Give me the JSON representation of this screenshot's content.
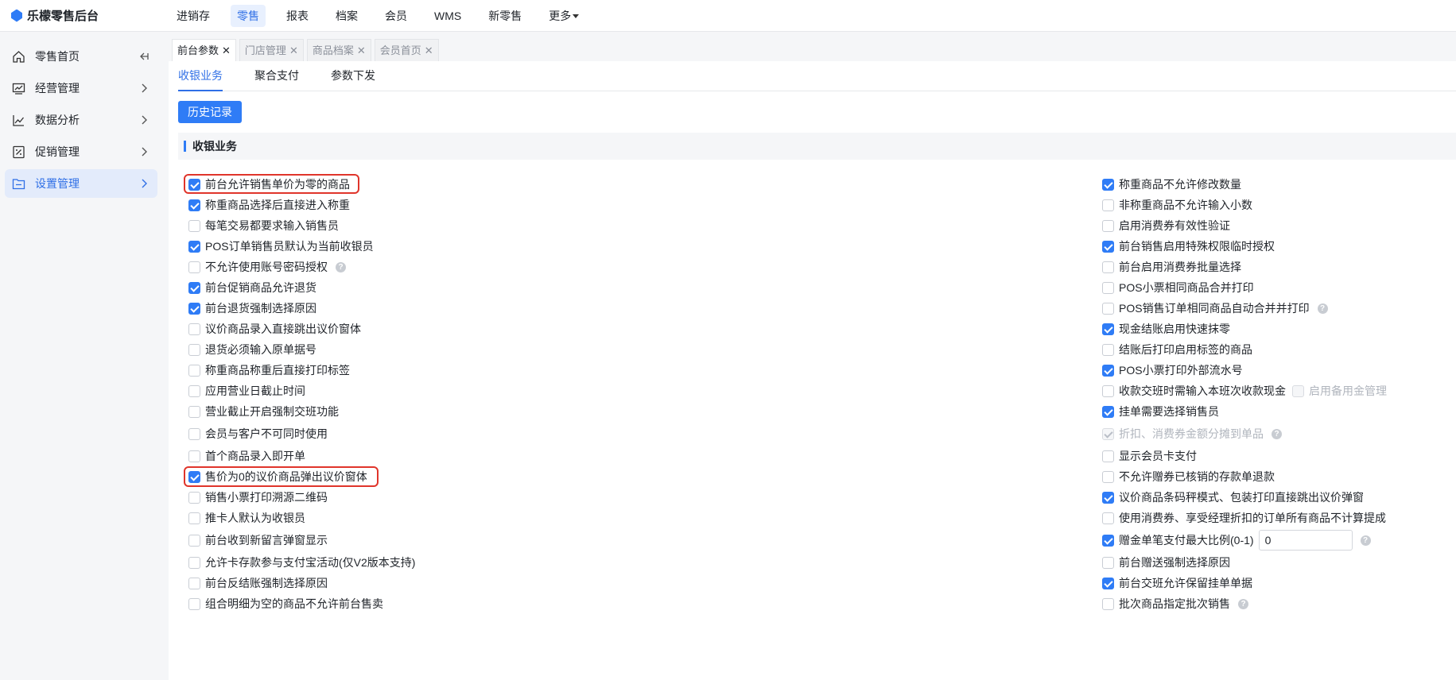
{
  "app": {
    "title": "乐檬零售后台"
  },
  "topnav": {
    "items": [
      {
        "label": "进销存",
        "active": false
      },
      {
        "label": "零售",
        "active": true
      },
      {
        "label": "报表",
        "active": false
      },
      {
        "label": "档案",
        "active": false
      },
      {
        "label": "会员",
        "active": false
      },
      {
        "label": "WMS",
        "active": false
      },
      {
        "label": "新零售",
        "active": false
      },
      {
        "label": "更多",
        "active": false
      }
    ]
  },
  "sidebar": {
    "items": [
      {
        "label": "零售首页",
        "icon": "home-icon",
        "active": false
      },
      {
        "label": "经营管理",
        "icon": "monitor-icon",
        "active": false
      },
      {
        "label": "数据分析",
        "icon": "chart-line-icon",
        "active": false
      },
      {
        "label": "促销管理",
        "icon": "promo-icon",
        "active": false
      },
      {
        "label": "设置管理",
        "icon": "folder-icon",
        "active": true
      }
    ]
  },
  "pageTabs": [
    {
      "label": "前台参数",
      "active": true
    },
    {
      "label": "门店管理",
      "active": false
    },
    {
      "label": "商品档案",
      "active": false
    },
    {
      "label": "会员首页",
      "active": false
    }
  ],
  "subTabs": [
    {
      "label": "收银业务",
      "active": true
    },
    {
      "label": "聚合支付",
      "active": false
    },
    {
      "label": "参数下发",
      "active": false
    }
  ],
  "historyButton": "历史记录",
  "section": {
    "title": "收银业务"
  },
  "leftOptions": [
    {
      "label": "前台允许销售单价为零的商品",
      "checked": true
    },
    {
      "label": "称重商品选择后直接进入称重",
      "checked": true
    },
    {
      "label": "每笔交易都要求输入销售员",
      "checked": false
    },
    {
      "label": "POS订单销售员默认为当前收银员",
      "checked": true
    },
    {
      "label": "不允许使用账号密码授权",
      "checked": false,
      "help": "?"
    },
    {
      "label": "前台促销商品允许退货",
      "checked": true
    },
    {
      "label": "前台退货强制选择原因",
      "checked": true
    },
    {
      "label": "议价商品录入直接跳出议价窗体",
      "checked": false
    },
    {
      "label": "退货必须输入原单据号",
      "checked": false
    },
    {
      "label": "称重商品称重后直接打印标签",
      "checked": false
    },
    {
      "label": "应用营业日截止时间",
      "checked": false
    },
    {
      "label": "营业截止开启强制交班功能",
      "checked": false
    },
    {
      "label": "会员与客户不可同时使用",
      "checked": false
    },
    {
      "label": "首个商品录入即开单",
      "checked": false
    },
    {
      "label": "售价为0的议价商品弹出议价窗体",
      "checked": true
    },
    {
      "label": "销售小票打印溯源二维码",
      "checked": false
    },
    {
      "label": "推卡人默认为收银员",
      "checked": false
    },
    {
      "label": "前台收到新留言弹窗显示",
      "checked": false
    },
    {
      "label": "允许卡存款参与支付宝活动(仅V2版本支持)",
      "checked": false
    },
    {
      "label": "前台反结账强制选择原因",
      "checked": false
    },
    {
      "label": "组合明细为空的商品不允许前台售卖",
      "checked": false
    }
  ],
  "rightOptions": [
    {
      "label": "称重商品不允许修改数量",
      "checked": true
    },
    {
      "label": "非称重商品不允许输入小数",
      "checked": false
    },
    {
      "label": "启用消费券有效性验证",
      "checked": false
    },
    {
      "label": "前台销售启用特殊权限临时授权",
      "checked": true
    },
    {
      "label": "前台启用消费券批量选择",
      "checked": false
    },
    {
      "label": "POS小票相同商品合并打印",
      "checked": false
    },
    {
      "label": "POS销售订单相同商品自动合并并打印",
      "checked": false,
      "help": "?"
    },
    {
      "label": "现金结账启用快速抹零",
      "checked": true
    },
    {
      "label": "结账后打印启用标签的商品",
      "checked": false
    },
    {
      "label": "POS小票打印外部流水号",
      "checked": true
    },
    {
      "label": "收款交班时需输入本班次收款现金",
      "checked": false,
      "extra": "启用备用金管理"
    },
    {
      "label": "挂单需要选择销售员",
      "checked": true
    },
    {
      "label": "折扣、消费券金额分摊到单品",
      "checked": true,
      "disabled": true,
      "help": "?"
    },
    {
      "label": "显示会员卡支付",
      "checked": false
    },
    {
      "label": "不允许赠券已核销的存款单退款",
      "checked": false
    },
    {
      "label": "议价商品条码秤模式、包装打印直接跳出议价弹窗",
      "checked": true
    },
    {
      "label": "使用消费券、享受经理折扣的订单所有商品不计算提成",
      "checked": false
    },
    {
      "label": "赠金单笔支付最大比例(0-1)",
      "checked": true,
      "input": "0",
      "help": "?"
    },
    {
      "label": "前台赠送强制选择原因",
      "checked": false
    },
    {
      "label": "前台交班允许保留挂单单据",
      "checked": true
    },
    {
      "label": "批次商品指定批次销售",
      "checked": false,
      "help": "?"
    }
  ],
  "colors": {
    "accent": "#2f7cf6",
    "highlight": "#e0352b"
  }
}
